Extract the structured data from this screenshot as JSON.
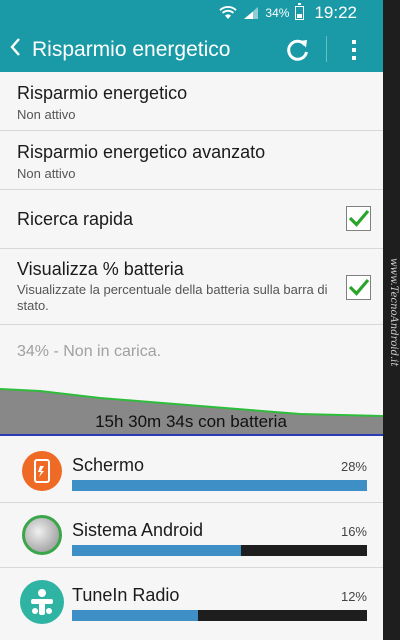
{
  "status_bar": {
    "battery_percent": "34%",
    "time": "19:22",
    "icons": [
      "wifi-icon",
      "signal-icon",
      "battery-icon"
    ]
  },
  "action_bar": {
    "title": "Risparmio energetico",
    "icons": [
      "back-arrow-icon",
      "refresh-icon",
      "more-options-icon"
    ],
    "color": "#1a9aa6"
  },
  "settings": [
    {
      "title": "Risparmio energetico",
      "subtitle": "Non attivo"
    },
    {
      "title": "Risparmio energetico avanzato",
      "subtitle": "Non attivo"
    },
    {
      "title": "Ricerca rapida",
      "checked": true
    },
    {
      "title": "Visualizza % batteria",
      "subtitle": "Visualizzate la percentuale della batteria sulla barra di stato.",
      "checked": true
    }
  ],
  "battery_status": "34% - Non in carica.",
  "graph": {
    "label": "15h 30m 34s con batteria",
    "line_color": "#2ebd3a",
    "fill_color": "#888888"
  },
  "apps": [
    {
      "name": "Schermo",
      "percent": "28%",
      "value": 28,
      "icon": "screen-icon"
    },
    {
      "name": "Sistema Android",
      "percent": "16%",
      "value": 16,
      "icon": "android-system-icon"
    },
    {
      "name": "TuneIn Radio",
      "percent": "12%",
      "value": 12,
      "icon": "tunein-radio-icon"
    }
  ],
  "bar_fill_color": "#3d8fc6",
  "watermark": "www.TecnoAndroid.it"
}
